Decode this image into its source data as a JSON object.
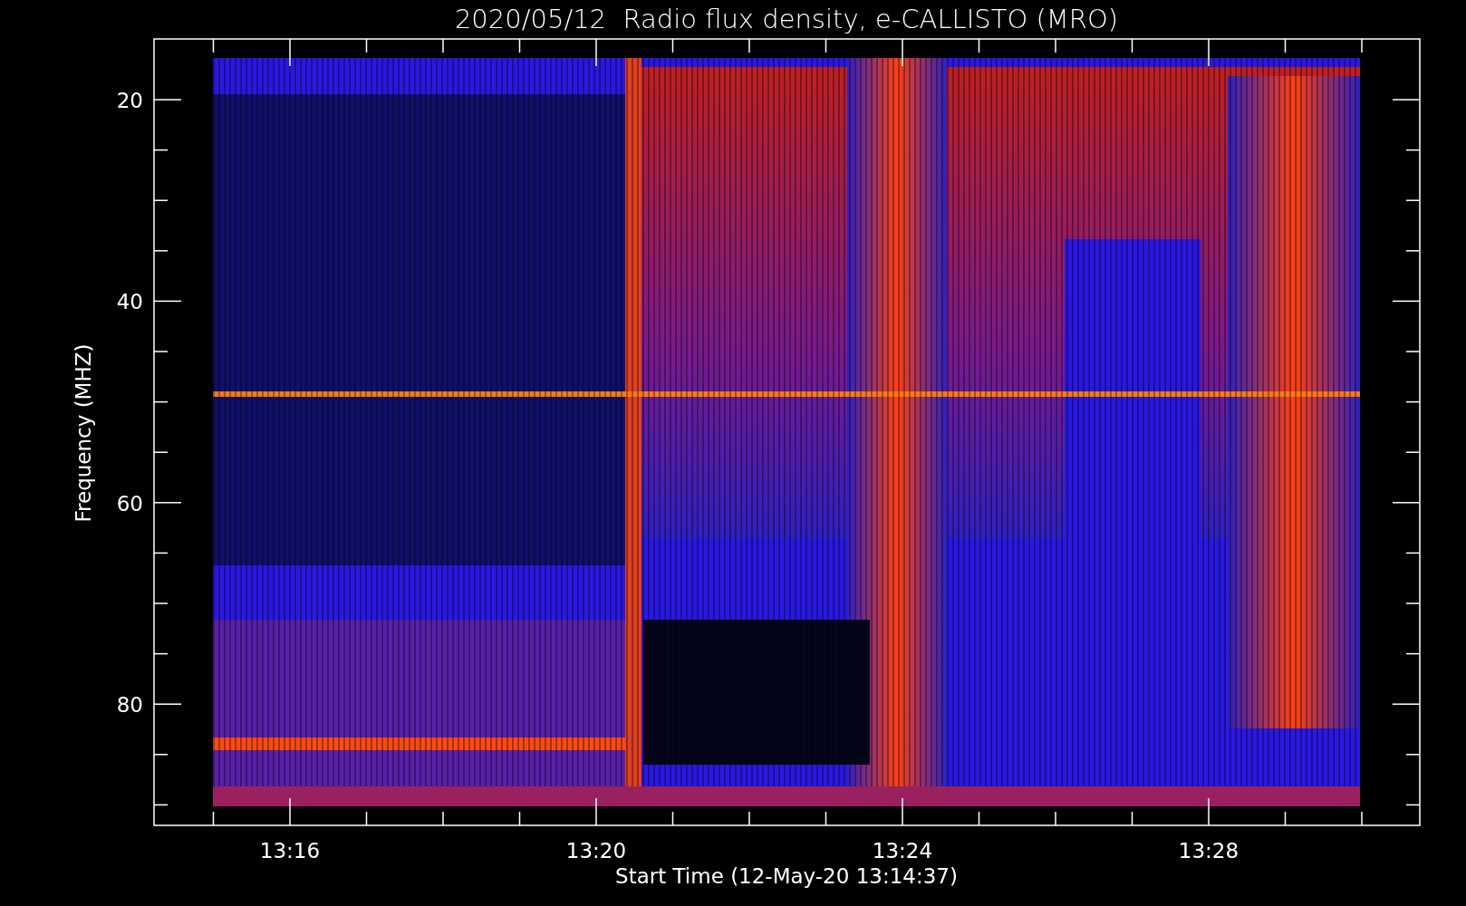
{
  "plot": {
    "title": "2020/05/12  Radio flux density, e-CALLISTO (MRO)",
    "ylabel": "Frequency (MHZ)",
    "xlabel": "Start Time (12-May-20 13:14:37)",
    "yticks": [
      "20",
      "40",
      "60",
      "80"
    ],
    "xticks": [
      "13:16",
      "13:20",
      "13:24",
      "13:28"
    ]
  }
}
